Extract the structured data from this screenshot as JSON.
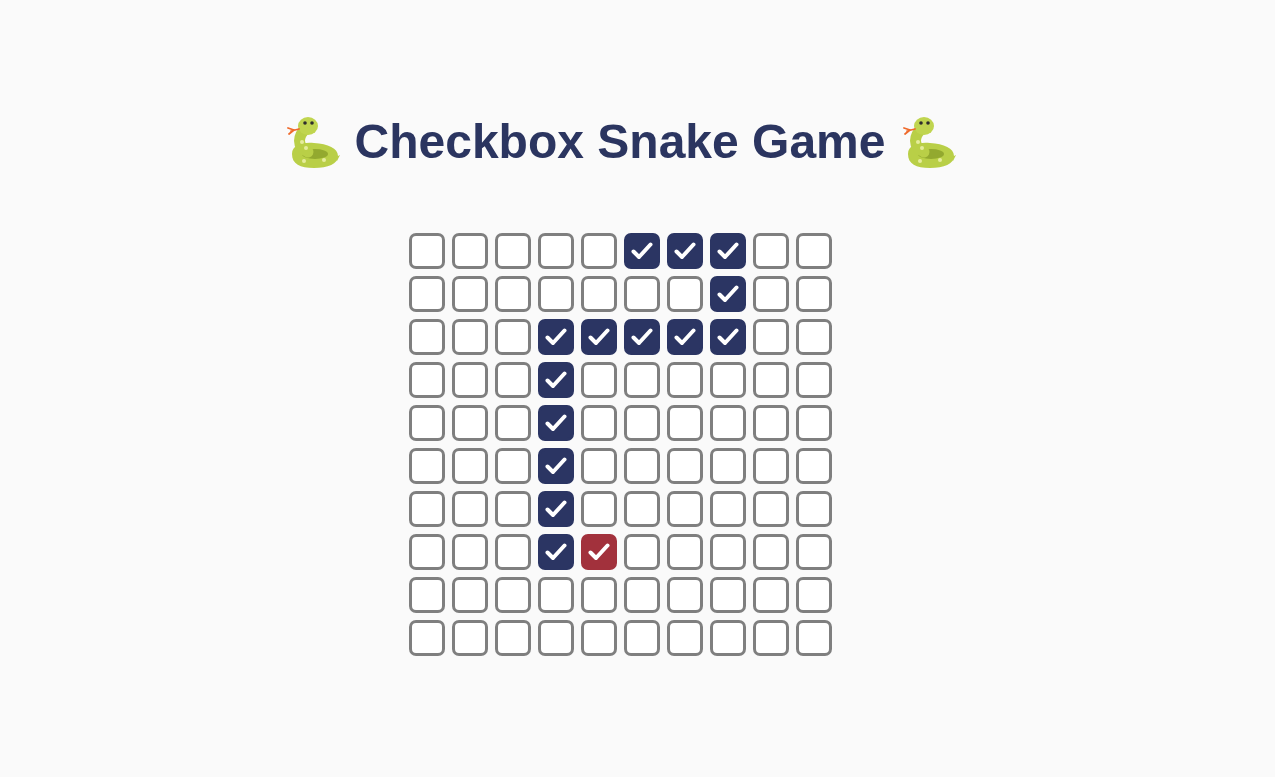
{
  "title": "Checkbox Snake Game",
  "board": {
    "rows": [
      [
        {
          "checked": false,
          "kind": "cell"
        },
        {
          "checked": false,
          "kind": "cell"
        },
        {
          "checked": false,
          "kind": "cell"
        },
        {
          "checked": false,
          "kind": "cell"
        },
        {
          "checked": false,
          "kind": "cell"
        },
        {
          "checked": true,
          "kind": "cell"
        },
        {
          "checked": true,
          "kind": "cell"
        },
        {
          "checked": true,
          "kind": "cell"
        },
        {
          "checked": false,
          "kind": "cell"
        },
        {
          "checked": false,
          "kind": "cell"
        }
      ],
      [
        {
          "checked": false,
          "kind": "cell"
        },
        {
          "checked": false,
          "kind": "cell"
        },
        {
          "checked": false,
          "kind": "cell"
        },
        {
          "checked": false,
          "kind": "cell"
        },
        {
          "checked": false,
          "kind": "cell"
        },
        {
          "checked": false,
          "kind": "cell"
        },
        {
          "checked": false,
          "kind": "cell"
        },
        {
          "checked": true,
          "kind": "cell"
        },
        {
          "checked": false,
          "kind": "cell"
        },
        {
          "checked": false,
          "kind": "cell"
        }
      ],
      [
        {
          "checked": false,
          "kind": "cell"
        },
        {
          "checked": false,
          "kind": "cell"
        },
        {
          "checked": false,
          "kind": "cell"
        },
        {
          "checked": true,
          "kind": "cell"
        },
        {
          "checked": true,
          "kind": "cell"
        },
        {
          "checked": true,
          "kind": "cell"
        },
        {
          "checked": true,
          "kind": "cell"
        },
        {
          "checked": true,
          "kind": "cell"
        },
        {
          "checked": false,
          "kind": "cell"
        },
        {
          "checked": false,
          "kind": "cell"
        }
      ],
      [
        {
          "checked": false,
          "kind": "cell"
        },
        {
          "checked": false,
          "kind": "cell"
        },
        {
          "checked": false,
          "kind": "cell"
        },
        {
          "checked": true,
          "kind": "cell"
        },
        {
          "checked": false,
          "kind": "cell"
        },
        {
          "checked": false,
          "kind": "cell"
        },
        {
          "checked": false,
          "kind": "cell"
        },
        {
          "checked": false,
          "kind": "cell"
        },
        {
          "checked": false,
          "kind": "cell"
        },
        {
          "checked": false,
          "kind": "cell"
        }
      ],
      [
        {
          "checked": false,
          "kind": "cell"
        },
        {
          "checked": false,
          "kind": "cell"
        },
        {
          "checked": false,
          "kind": "cell"
        },
        {
          "checked": true,
          "kind": "cell"
        },
        {
          "checked": false,
          "kind": "cell"
        },
        {
          "checked": false,
          "kind": "cell"
        },
        {
          "checked": false,
          "kind": "cell"
        },
        {
          "checked": false,
          "kind": "cell"
        },
        {
          "checked": false,
          "kind": "cell"
        },
        {
          "checked": false,
          "kind": "cell"
        }
      ],
      [
        {
          "checked": false,
          "kind": "cell"
        },
        {
          "checked": false,
          "kind": "cell"
        },
        {
          "checked": false,
          "kind": "cell"
        },
        {
          "checked": true,
          "kind": "cell"
        },
        {
          "checked": false,
          "kind": "cell"
        },
        {
          "checked": false,
          "kind": "cell"
        },
        {
          "checked": false,
          "kind": "cell"
        },
        {
          "checked": false,
          "kind": "cell"
        },
        {
          "checked": false,
          "kind": "cell"
        },
        {
          "checked": false,
          "kind": "cell"
        }
      ],
      [
        {
          "checked": false,
          "kind": "cell"
        },
        {
          "checked": false,
          "kind": "cell"
        },
        {
          "checked": false,
          "kind": "cell"
        },
        {
          "checked": true,
          "kind": "cell"
        },
        {
          "checked": false,
          "kind": "cell"
        },
        {
          "checked": false,
          "kind": "cell"
        },
        {
          "checked": false,
          "kind": "cell"
        },
        {
          "checked": false,
          "kind": "cell"
        },
        {
          "checked": false,
          "kind": "cell"
        },
        {
          "checked": false,
          "kind": "cell"
        }
      ],
      [
        {
          "checked": false,
          "kind": "cell"
        },
        {
          "checked": false,
          "kind": "cell"
        },
        {
          "checked": false,
          "kind": "cell"
        },
        {
          "checked": true,
          "kind": "cell"
        },
        {
          "checked": true,
          "kind": "food"
        },
        {
          "checked": false,
          "kind": "cell"
        },
        {
          "checked": false,
          "kind": "cell"
        },
        {
          "checked": false,
          "kind": "cell"
        },
        {
          "checked": false,
          "kind": "cell"
        },
        {
          "checked": false,
          "kind": "cell"
        }
      ],
      [
        {
          "checked": false,
          "kind": "cell"
        },
        {
          "checked": false,
          "kind": "cell"
        },
        {
          "checked": false,
          "kind": "cell"
        },
        {
          "checked": false,
          "kind": "cell"
        },
        {
          "checked": false,
          "kind": "cell"
        },
        {
          "checked": false,
          "kind": "cell"
        },
        {
          "checked": false,
          "kind": "cell"
        },
        {
          "checked": false,
          "kind": "cell"
        },
        {
          "checked": false,
          "kind": "cell"
        },
        {
          "checked": false,
          "kind": "cell"
        }
      ],
      [
        {
          "checked": false,
          "kind": "cell"
        },
        {
          "checked": false,
          "kind": "cell"
        },
        {
          "checked": false,
          "kind": "cell"
        },
        {
          "checked": false,
          "kind": "cell"
        },
        {
          "checked": false,
          "kind": "cell"
        },
        {
          "checked": false,
          "kind": "cell"
        },
        {
          "checked": false,
          "kind": "cell"
        },
        {
          "checked": false,
          "kind": "cell"
        },
        {
          "checked": false,
          "kind": "cell"
        },
        {
          "checked": false,
          "kind": "cell"
        }
      ]
    ]
  }
}
